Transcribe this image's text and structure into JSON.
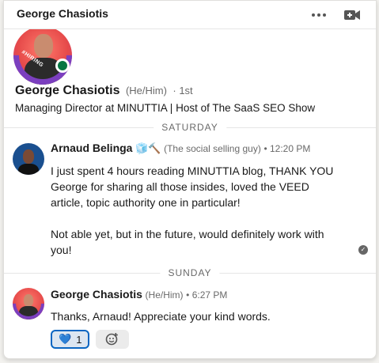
{
  "header": {
    "title": "George Chasiotis",
    "more_icon": "more-horizontal-icon",
    "video_icon": "video-call-icon"
  },
  "profile": {
    "name": "George Chasiotis",
    "pronouns": "(He/Him)",
    "degree": "· 1st",
    "headline": "Managing Director at MINUTTIA | Host of The SaaS SEO Show",
    "badge_text": "#HIRING",
    "online": true
  },
  "dividers": {
    "saturday": "SATURDAY",
    "sunday": "SUNDAY"
  },
  "messages": [
    {
      "sender": "Arnaud Belinga",
      "emoji": "🧊🔨",
      "tagline": "(The social selling guy)",
      "time": "• 12:20 PM",
      "paragraphs": [
        "I just spent 4 hours reading MINUTTIA blog, THANK YOU George for sharing all those insides, loved the VEED article, topic authority one in particular!",
        "Not able yet, but in the future, would definitely work with you!"
      ],
      "read_icon": "read-receipt-icon"
    },
    {
      "sender": "George Chasiotis",
      "pronouns": "(He/Him)",
      "time": "• 6:27 PM",
      "text": "Thanks, Arnaud! Appreciate your kind words.",
      "reaction_emoji": "💙",
      "reaction_count": "1",
      "add_reaction_icon": "add-reaction-icon"
    }
  ],
  "colors": {
    "online": "#057642",
    "accent": "#0a66c2",
    "hiring": "#7b3fbf"
  }
}
